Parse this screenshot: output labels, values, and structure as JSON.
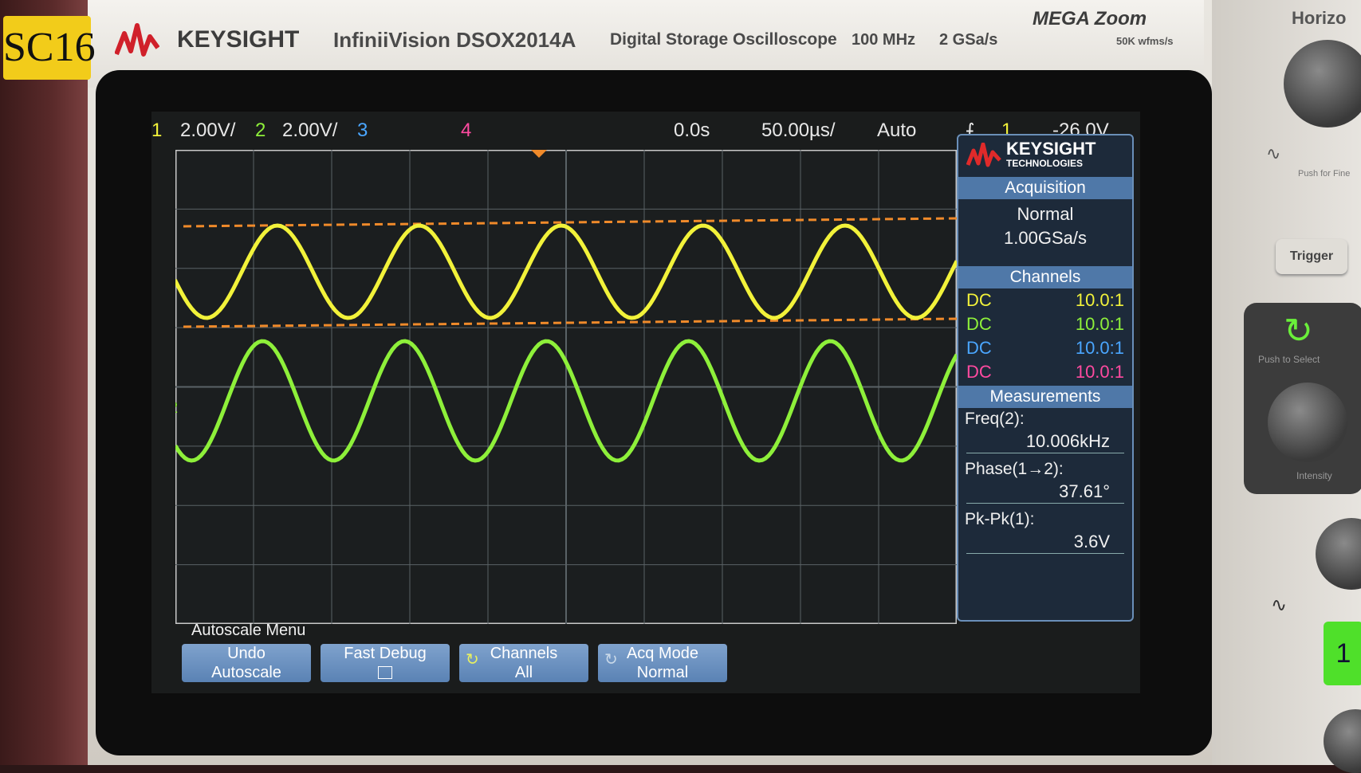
{
  "header": {
    "brand": "KEYSIGHT",
    "model": "InfiniiVision DSOX2014A",
    "description": "Digital Storage Oscilloscope",
    "bandwidth": "100 MHz",
    "sample_rate": "2 GSa/s",
    "megazoom": "MEGA Zoom",
    "megazoom_sub": "50K wfms/s",
    "sticker": "SC16"
  },
  "status_bar": {
    "ch1_num": "1",
    "ch1_scale": "2.00V/",
    "ch2_num": "2",
    "ch2_scale": "2.00V/",
    "ch3_num": "3",
    "ch4_num": "4",
    "time_offset": "0.0s",
    "time_scale": "50.00µs/",
    "trigger_mode": "Auto",
    "trigger_source": "1",
    "trigger_level": "-26.0V"
  },
  "side_panel": {
    "logo": "KEYSIGHT",
    "logo_sub": "TECHNOLOGIES",
    "acquisition_title": "Acquisition",
    "acq_mode": "Normal",
    "acq_rate": "1.00GSa/s",
    "channels_title": "Channels",
    "channels": [
      {
        "coupling": "DC",
        "probe": "10.0:1",
        "color": "#f2f23a"
      },
      {
        "coupling": "DC",
        "probe": "10.0:1",
        "color": "#8ef03a"
      },
      {
        "coupling": "DC",
        "probe": "10.0:1",
        "color": "#4aa6ff"
      },
      {
        "coupling": "DC",
        "probe": "10.0:1",
        "color": "#ff4aa0"
      }
    ],
    "measurements_title": "Measurements",
    "measurements": [
      {
        "label": "Freq(2):",
        "value": "10.006kHz"
      },
      {
        "label": "Phase(1→2):",
        "value": "37.61°"
      },
      {
        "label": "Pk-Pk(1):",
        "value": "3.6V"
      }
    ]
  },
  "softkeys": {
    "menu_title": "Autoscale Menu",
    "undo_l1": "Undo",
    "undo_l2": "Autoscale",
    "fast_debug": "Fast Debug",
    "channels_l1": "Channels",
    "channels_l2": "All",
    "acq_l1": "Acq Mode",
    "acq_l2": "Normal"
  },
  "front_panel": {
    "horizontal_label": "Horizo",
    "push_fine": "Push for Fine",
    "trigger_button": "Trigger",
    "push_select": "Push to Select",
    "intensity": "Intensity",
    "channel_button": "1"
  },
  "colors": {
    "ch1": "#f2f23a",
    "ch2": "#8ef03a",
    "cursor": "#f08a2a",
    "grid": "#5a6266"
  }
}
